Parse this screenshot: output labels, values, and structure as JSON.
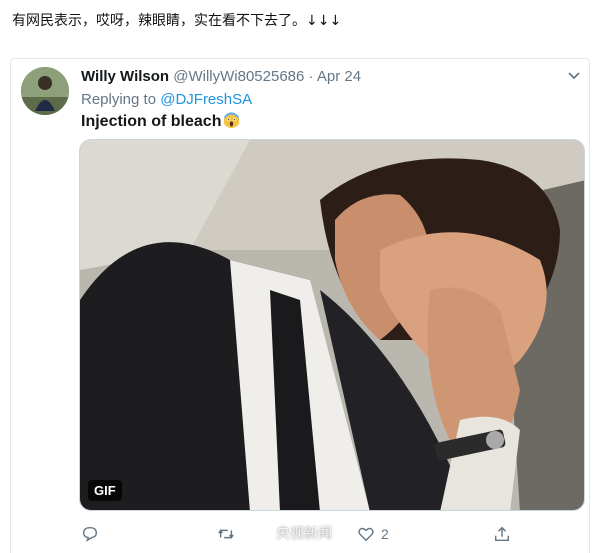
{
  "caption": "有网民表示，哎呀，辣眼睛，实在看不下去了。↓↓↓",
  "tweet": {
    "name": "Willy Wilson",
    "handle": "@WillyWi80525686",
    "separator": "·",
    "date": "Apr 24",
    "replying_prefix": "Replying to ",
    "replying_to": "@DJFreshSA",
    "text": "Injection of bleach",
    "emoji": "face-screaming-in-fear-emoji"
  },
  "media": {
    "badge": "GIF"
  },
  "actions": {
    "reply_icon": "reply-icon",
    "retweet_icon": "retweet-icon",
    "like_icon": "heart-icon",
    "like_count": "2",
    "share_icon": "share-icon"
  },
  "watermark": "央视新闻",
  "colors": {
    "link": "#1b95e0",
    "muted": "#657786",
    "border": "#e1e8ed"
  }
}
